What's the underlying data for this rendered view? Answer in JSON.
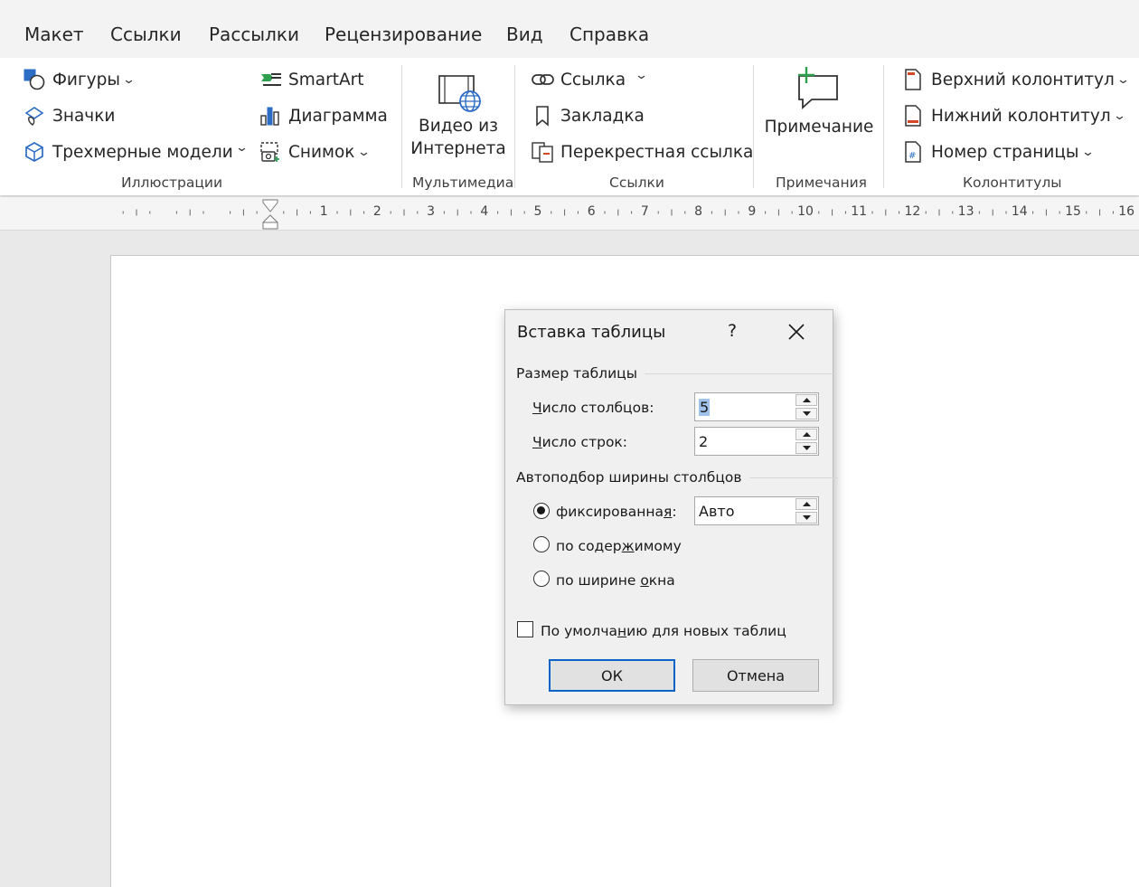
{
  "tabs": [
    "Макет",
    "Ссылки",
    "Рассылки",
    "Рецензирование",
    "Вид",
    "Справка"
  ],
  "ribbon": {
    "illustrations": {
      "shapes": "Фигуры",
      "icons": "Значки",
      "models_3d": "Трехмерные модели",
      "smartart": "SmartArt",
      "chart": "Диаграмма",
      "screenshot": "Снимок",
      "group_label": "Иллюстрации"
    },
    "media": {
      "online_video_line1": "Видео из",
      "online_video_line2": "Интернета",
      "group_label": "Мультимедиа"
    },
    "links": {
      "link": "Ссылка",
      "bookmark": "Закладка",
      "cross_reference": "Перекрестная ссылка",
      "group_label": "Ссылки"
    },
    "comments": {
      "comment": "Примечание",
      "group_label": "Примечания"
    },
    "header_footer": {
      "header": "Верхний колонтитул",
      "footer": "Нижний колонтитул",
      "page_number": "Номер страницы",
      "group_label": "Колонтитулы"
    },
    "accent_green": "#2e9e4f",
    "accent_blue": "#2b6cc4"
  },
  "ruler": {
    "numbers": [
      "1",
      "2",
      "3",
      "4",
      "5",
      "6",
      "7",
      "8",
      "9",
      "10",
      "11",
      "12",
      "13",
      "14",
      "15",
      "16"
    ]
  },
  "dialog": {
    "title": "Вставка таблицы",
    "help": "?",
    "size_section": "Размер таблицы",
    "columns_label_u": "Ч",
    "columns_label_rest": "исло столбцов:",
    "columns_value": "5",
    "rows_label_u": "Ч",
    "rows_label_rest": "исло строк:",
    "rows_value": "2",
    "autofit_section": "Автоподбор ширины столбцов",
    "fixed_pre": "фиксированна",
    "fixed_u": "я",
    "fixed_post": ":",
    "fixed_value": "Авто",
    "content_pre": "по содер",
    "content_u": "ж",
    "content_post": "имому",
    "window_pre": "по ширине ",
    "window_u": "о",
    "window_post": "кна",
    "default_pre": "По умолча",
    "default_u": "н",
    "default_post": "ию для новых таблиц",
    "ok": "ОК",
    "cancel": "Отмена",
    "selected_autofit": "фиксированная",
    "default_checked": false
  }
}
